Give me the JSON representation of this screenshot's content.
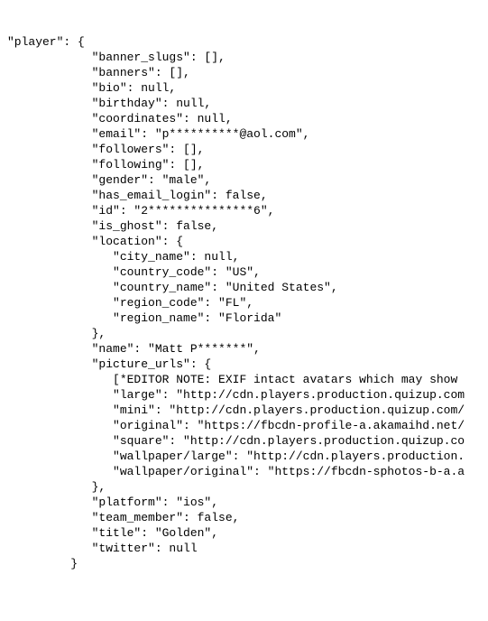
{
  "lines": {
    "l0": "\"player\": {",
    "l1": "            \"banner_slugs\": [],",
    "l2": "            \"banners\": [],",
    "l3": "            \"bio\": null,",
    "l4": "            \"birthday\": null,",
    "l5": "            \"coordinates\": null,",
    "l6": "            \"email\": \"p**********@aol.com\",",
    "l7": "            \"followers\": [],",
    "l8": "            \"following\": [],",
    "l9": "            \"gender\": \"male\",",
    "l10": "            \"has_email_login\": false,",
    "l11": "            \"id\": \"2***************6\",",
    "l12": "            \"is_ghost\": false,",
    "l13": "            \"location\": {",
    "l14": "               \"city_name\": null,",
    "l15": "               \"country_code\": \"US\",",
    "l16": "               \"country_name\": \"United States\",",
    "l17": "               \"region_code\": \"FL\",",
    "l18": "               \"region_name\": \"Florida\"",
    "l19": "            },",
    "l20": "            \"name\": \"Matt P*******\",",
    "l21": "            \"picture_urls\": {",
    "l22": "               [*EDITOR NOTE: EXIF intact avatars which may show ",
    "l23": "               \"large\": \"http://cdn.players.production.quizup.com",
    "l24": "               \"mini\": \"http://cdn.players.production.quizup.com/",
    "l25": "               \"original\": \"https://fbcdn-profile-a.akamaihd.net/",
    "l26": "               \"square\": \"http://cdn.players.production.quizup.co",
    "l27": "               \"wallpaper/large\": \"http://cdn.players.production.",
    "l28": "               \"wallpaper/original\": \"https://fbcdn-sphotos-b-a.a",
    "l29": "            },",
    "l30": "            \"platform\": \"ios\",",
    "l31": "            \"team_member\": false,",
    "l32": "            \"title\": \"Golden\",",
    "l33": "            \"twitter\": null",
    "l34": "         }"
  }
}
